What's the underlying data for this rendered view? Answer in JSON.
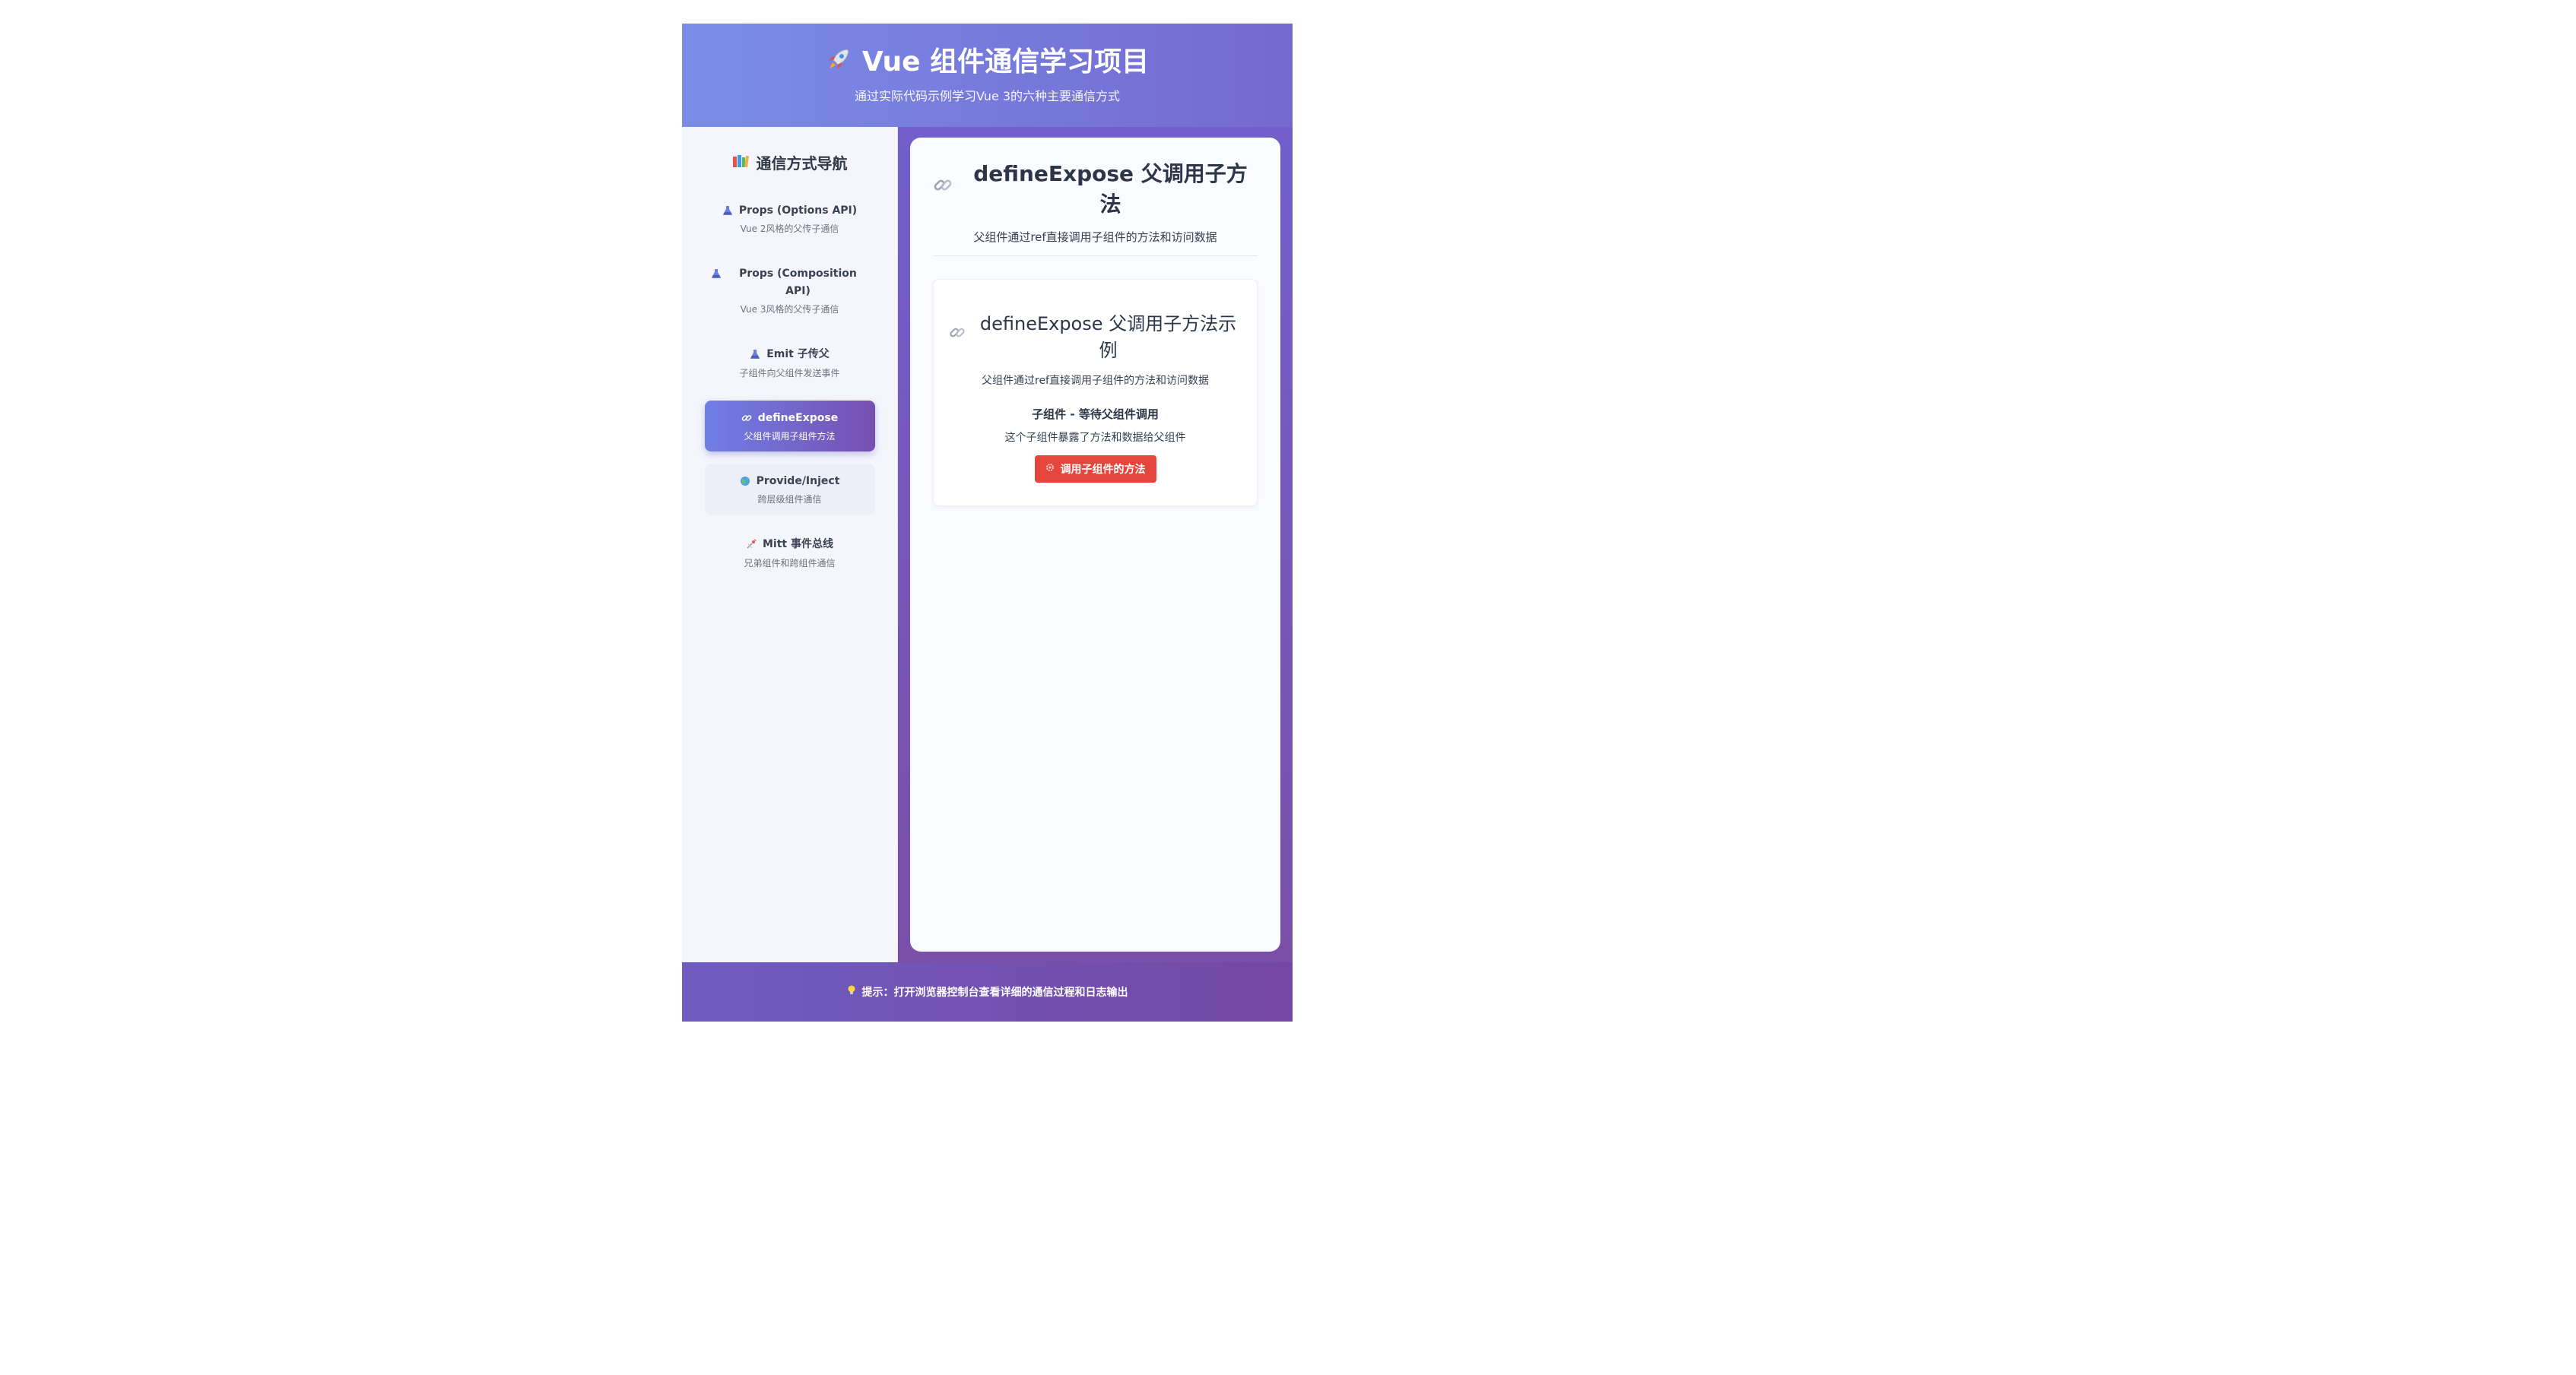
{
  "header": {
    "title": "Vue 组件通信学习项目",
    "subtitle": "通过实际代码示例学习Vue 3的六种主要通信方式",
    "icon": "rocket-icon"
  },
  "sidebar": {
    "title": "通信方式导航",
    "title_icon": "books-icon",
    "items": [
      {
        "label": "Props (Options API)",
        "desc": "Vue 2风格的父传子通信",
        "icon": "flask-icon",
        "state": "normal"
      },
      {
        "label": "Props (Composition API)",
        "desc": "Vue 3风格的父传子通信",
        "icon": "flask-icon",
        "state": "normal"
      },
      {
        "label": "Emit 子传父",
        "desc": "子组件向父组件发送事件",
        "icon": "flask-icon",
        "state": "normal"
      },
      {
        "label": "defineExpose",
        "desc": "父组件调用子组件方法",
        "icon": "link-icon",
        "state": "active"
      },
      {
        "label": "Provide/Inject",
        "desc": "跨层级组件通信",
        "icon": "globe-icon",
        "state": "hover"
      },
      {
        "label": "Mitt 事件总线",
        "desc": "兄弟组件和跨组件通信",
        "icon": "satellite-icon",
        "state": "normal"
      }
    ]
  },
  "main": {
    "title": "defineExpose 父调用子方法",
    "desc": "父组件通过ref直接调用子组件的方法和访问数据",
    "demo": {
      "title": "defineExpose 父调用子方法示例",
      "desc": "父组件通过ref直接调用子组件的方法和访问数据",
      "child_title": "子组件 - 等待父组件调用",
      "child_desc": "这个子组件暴露了方法和数据给父组件",
      "button_label": "调用子组件的方法"
    }
  },
  "footer": {
    "tip": "提示：打开浏览器控制台查看详细的通信过程和日志输出",
    "icon": "lightbulb-icon"
  },
  "colors": {
    "header_start": "#7b8de8",
    "header_end": "#7369cf",
    "accent": "#725fcc",
    "button": "#e6453b"
  }
}
